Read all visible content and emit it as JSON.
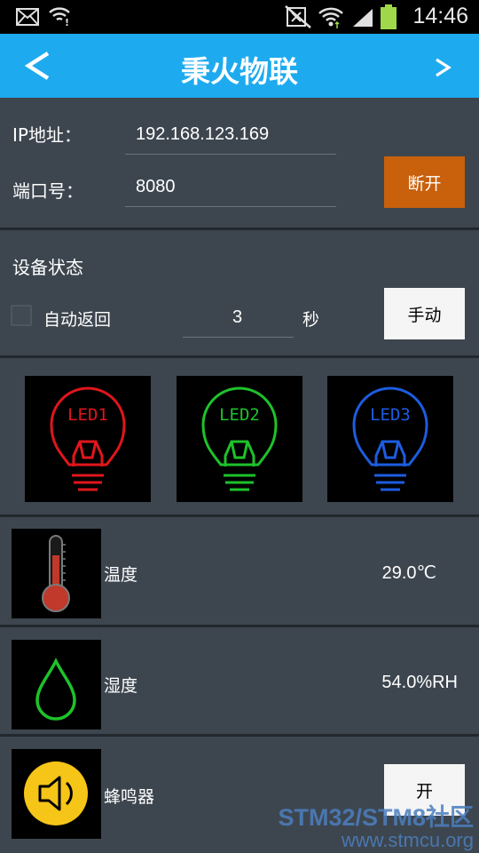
{
  "status_bar": {
    "time": "14:46",
    "icons": [
      "mail-icon",
      "wifi-alert-icon",
      "mute-icon",
      "wifi-icon",
      "signal-icon",
      "battery-icon"
    ]
  },
  "header": {
    "title": "秉火物联",
    "back_icon": "chevron-left-icon",
    "forward_icon": "chevron-right-icon",
    "color": "#1eaaef"
  },
  "connection": {
    "ip_label": "IP地址：",
    "ip_value": "192.168.123.169",
    "port_label": "端口号：",
    "port_value": "8080",
    "disconnect_label": "断开",
    "disconnect_color": "#c8600c"
  },
  "device_status": {
    "heading": "设备状态",
    "auto_return_label": "自动返回",
    "auto_return_checked": false,
    "seconds_value": "3",
    "seconds_unit": "秒",
    "manual_label": "手动"
  },
  "leds": [
    {
      "label": "LED1",
      "color": "#e0161c"
    },
    {
      "label": "LED2",
      "color": "#1ec22a"
    },
    {
      "label": "LED3",
      "color": "#1d5ce0"
    }
  ],
  "sensors": [
    {
      "icon": "thermometer-icon",
      "label": "温度",
      "value": "29.0℃"
    },
    {
      "icon": "water-drop-icon",
      "label": "湿度",
      "value": "54.0%RH"
    },
    {
      "icon": "speaker-icon",
      "label": "蜂鸣器",
      "button": "开"
    }
  ],
  "watermark": {
    "line1": "STM32/STM8社区",
    "line2": "www.stmcu.org"
  }
}
